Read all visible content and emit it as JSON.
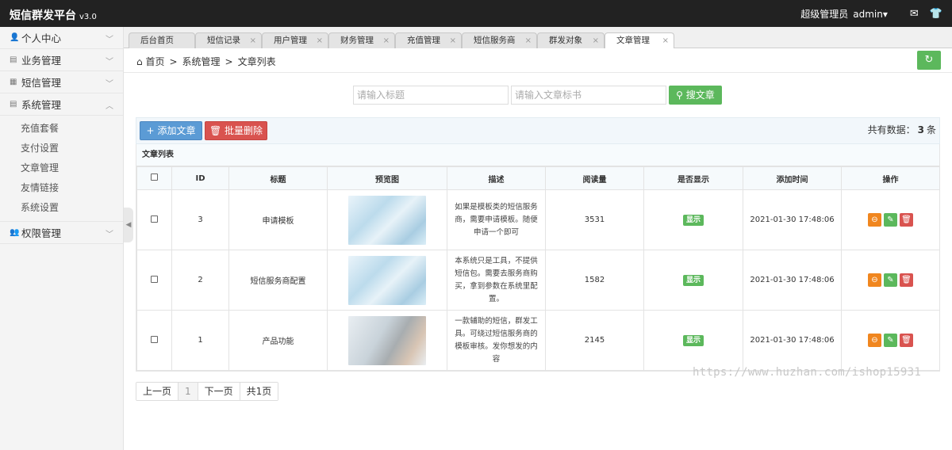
{
  "topbar": {
    "brand": "短信群发平台",
    "version": "v3.0",
    "role": "超级管理员",
    "user": "admin",
    "user_caret": "▾",
    "mail_icon": "✉",
    "shirt_icon": "👕"
  },
  "sidebar": {
    "groups": [
      {
        "label": "个人中心",
        "icon": "👤",
        "chev": "﹀"
      },
      {
        "label": "业务管理",
        "icon": "▤",
        "chev": "﹀"
      },
      {
        "label": "短信管理",
        "icon": "▦",
        "chev": "﹀"
      },
      {
        "label": "系统管理",
        "icon": "▤",
        "chev": "︿"
      },
      {
        "label": "权限管理",
        "icon": "👥",
        "chev": "﹀"
      }
    ],
    "sub_items": [
      "充值套餐",
      "支付设置",
      "文章管理",
      "友情链接",
      "系统设置"
    ],
    "collapse_icon": "◀"
  },
  "tabs": [
    {
      "label": "后台首页",
      "close": ""
    },
    {
      "label": "短信记录",
      "close": "×"
    },
    {
      "label": "用户管理",
      "close": "×"
    },
    {
      "label": "财务管理",
      "close": "×"
    },
    {
      "label": "充值管理",
      "close": "×"
    },
    {
      "label": "短信服务商",
      "close": "×"
    },
    {
      "label": "群发对象",
      "close": "×"
    },
    {
      "label": "文章管理",
      "close": "×"
    }
  ],
  "breadcrumb": {
    "home_icon": "⌂",
    "home": "首页",
    "sep": ">",
    "level1": "系统管理",
    "level2": "文章列表"
  },
  "refresh_icon": "↻",
  "search": {
    "title_placeholder": "请输入标题",
    "tag_placeholder": "请输入文章标书",
    "button_icon": "⚲",
    "button_label": "搜文章"
  },
  "toolbar": {
    "add_icon": "+",
    "add_label": "添加文章",
    "delete_icon": "🗑",
    "delete_label": "批量删除",
    "count_prefix": "共有数据：",
    "count_value": "3",
    "count_suffix": "条"
  },
  "table": {
    "caption": "文章列表",
    "headers": [
      "ID",
      "标题",
      "预览图",
      "描述",
      "阅读量",
      "是否显示",
      "添加时间",
      "操作"
    ],
    "rows": [
      {
        "id": "3",
        "title": "申请模板",
        "desc": "如果是模板类的短信服务商，需要申请模板。随便申请一个即可",
        "views": "3531",
        "status": "显示",
        "time": "2021-01-30 17:48:06"
      },
      {
        "id": "2",
        "title": "短信服务商配置",
        "desc": "本系统只是工具，不提供短信包。需要去服务商购买，拿到参数在系统里配置。",
        "views": "1582",
        "status": "显示",
        "time": "2021-01-30 17:48:06"
      },
      {
        "id": "1",
        "title": "产品功能",
        "desc": "一款辅助的短信，群发工具。可绕过短信服务商的模板审核。发你想发的内容",
        "views": "2145",
        "status": "显示",
        "time": "2021-01-30 17:48:06"
      }
    ],
    "op_icons": [
      "⊖",
      "✎",
      "🗑"
    ]
  },
  "pager": {
    "prev": "上一页",
    "current": "1",
    "next": "下一页",
    "total": "共1页"
  },
  "watermark": "https://www.huzhan.com/ishop15931"
}
